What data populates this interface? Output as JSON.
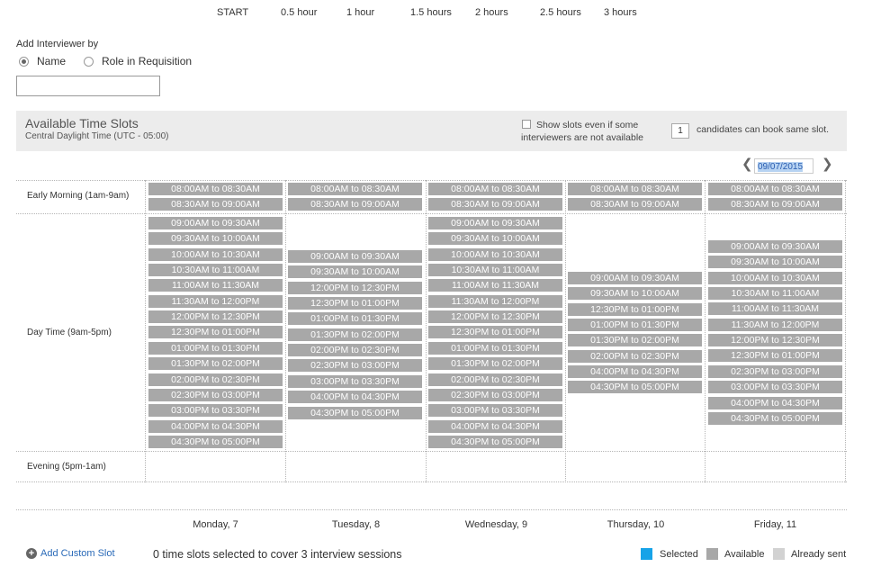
{
  "durations": [
    "START",
    "0.5 hour",
    "1 hour",
    "1.5 hours",
    "2 hours",
    "2.5 hours",
    "3 hours"
  ],
  "add_interviewer": {
    "label": "Add Interviewer by",
    "options": [
      "Name",
      "Role in Requisition"
    ],
    "selected": "Name",
    "input_value": ""
  },
  "slots_header": {
    "title": "Available Time Slots",
    "timezone": "Central Daylight Time (UTC - 05:00)",
    "show_slots_text": "Show slots even if some interviewers are not available",
    "candidates_value": "1",
    "candidates_text": "candidates can book same slot."
  },
  "date_nav": {
    "date": "09/07/2015"
  },
  "periods": [
    "Early Morning (1am-9am)",
    "Day Time (9am-5pm)",
    "Evening (5pm-1am)"
  ],
  "days": [
    {
      "name": "Monday, 7",
      "early": [
        "08:00AM to 08:30AM",
        "08:30AM to 09:00AM"
      ],
      "day": [
        "09:00AM to 09:30AM",
        "09:30AM to 10:00AM",
        "10:00AM to 10:30AM",
        "10:30AM to 11:00AM",
        "11:00AM to 11:30AM",
        "11:30AM to 12:00PM",
        "12:00PM to 12:30PM",
        "12:30PM to 01:00PM",
        "01:00PM to 01:30PM",
        "01:30PM to 02:00PM",
        "02:00PM to 02:30PM",
        "02:30PM to 03:00PM",
        "03:00PM to 03:30PM",
        "04:00PM to 04:30PM",
        "04:30PM to 05:00PM"
      ]
    },
    {
      "name": "Tuesday, 8",
      "early": [
        "08:00AM to 08:30AM",
        "08:30AM to 09:00AM"
      ],
      "day": [
        "09:00AM to 09:30AM",
        "09:30AM to 10:00AM",
        "12:00PM to 12:30PM",
        "12:30PM to 01:00PM",
        "01:00PM to 01:30PM",
        "01:30PM to 02:00PM",
        "02:00PM to 02:30PM",
        "02:30PM to 03:00PM",
        "03:00PM to 03:30PM",
        "04:00PM to 04:30PM",
        "04:30PM to 05:00PM"
      ]
    },
    {
      "name": "Wednesday, 9",
      "early": [
        "08:00AM to 08:30AM",
        "08:30AM to 09:00AM"
      ],
      "day": [
        "09:00AM to 09:30AM",
        "09:30AM to 10:00AM",
        "10:00AM to 10:30AM",
        "10:30AM to 11:00AM",
        "11:00AM to 11:30AM",
        "11:30AM to 12:00PM",
        "12:00PM to 12:30PM",
        "12:30PM to 01:00PM",
        "01:00PM to 01:30PM",
        "01:30PM to 02:00PM",
        "02:00PM to 02:30PM",
        "02:30PM to 03:00PM",
        "03:00PM to 03:30PM",
        "04:00PM to 04:30PM",
        "04:30PM to 05:00PM"
      ]
    },
    {
      "name": "Thursday, 10",
      "early": [
        "08:00AM to 08:30AM",
        "08:30AM to 09:00AM"
      ],
      "day": [
        "09:00AM to 09:30AM",
        "09:30AM to 10:00AM",
        "12:30PM to 01:00PM",
        "01:00PM to 01:30PM",
        "01:30PM to 02:00PM",
        "02:00PM to 02:30PM",
        "04:00PM to 04:30PM",
        "04:30PM to 05:00PM"
      ]
    },
    {
      "name": "Friday, 11",
      "early": [
        "08:00AM to 08:30AM",
        "08:30AM to 09:00AM"
      ],
      "day": [
        "09:00AM to 09:30AM",
        "09:30AM to 10:00AM",
        "10:00AM to 10:30AM",
        "10:30AM to 11:00AM",
        "11:00AM to 11:30AM",
        "11:30AM to 12:00PM",
        "12:00PM to 12:30PM",
        "12:30PM to 01:00PM",
        "02:30PM to 03:00PM",
        "03:00PM to 03:30PM",
        "04:00PM to 04:30PM",
        "04:30PM to 05:00PM"
      ]
    }
  ],
  "footer": {
    "add_custom_label": "Add Custom Slot",
    "summary": "0 time slots selected to cover 3 interview sessions",
    "legend": [
      {
        "label": "Selected",
        "color": "#17a3e8"
      },
      {
        "label": "Available",
        "color": "#a8a8a8"
      },
      {
        "label": "Already sent",
        "color": "#d2d2d2"
      }
    ]
  }
}
